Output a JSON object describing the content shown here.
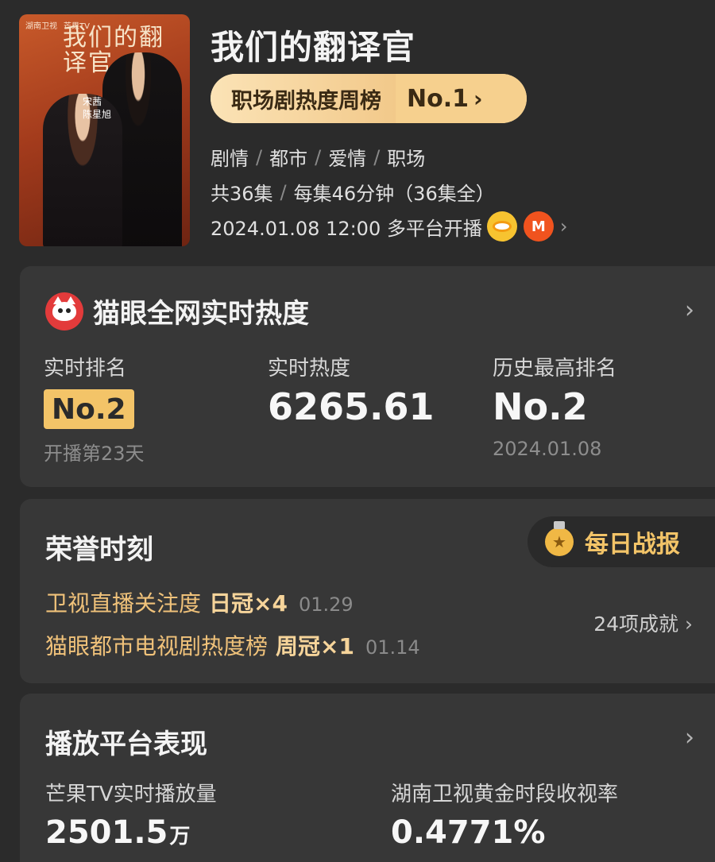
{
  "poster": {
    "logo_left": "湖南卫视",
    "logo_right": "芒果TV",
    "title_art": "我们的翻译官",
    "names": [
      "宋茜",
      "陈星旭"
    ]
  },
  "header": {
    "title": "我们的翻译官",
    "rank_label": "职场剧热度周榜",
    "rank_value": "No.1",
    "genres": [
      "剧情",
      "都市",
      "爱情",
      "职场"
    ],
    "episodes": "共36集",
    "duration": "每集46分钟（36集全）",
    "premiere": "2024.01.08 12:00 多平台开播",
    "platforms": [
      "hunan-tv-icon",
      "mango-tv-icon"
    ]
  },
  "heat_card": {
    "title": "猫眼全网实时热度",
    "stats": [
      {
        "label": "实时排名",
        "value": "No.2",
        "sub": "开播第23天"
      },
      {
        "label": "实时热度",
        "value": "6265.61",
        "sub": ""
      },
      {
        "label": "历史最高排名",
        "value": "No.2",
        "sub": "2024.01.08"
      }
    ]
  },
  "honor_card": {
    "title": "荣誉时刻",
    "daily_button": "每日战报",
    "items": [
      {
        "name": "卫视直播关注度",
        "crown": "日冠×4",
        "date": "01.29"
      },
      {
        "name": "猫眼都市电视剧热度榜",
        "crown": "周冠×1",
        "date": "01.14"
      }
    ],
    "achievements": "24项成就"
  },
  "platform_card": {
    "title": "播放平台表现",
    "metrics": [
      {
        "label": "芒果TV实时播放量",
        "value": "2501.5",
        "unit": "万"
      },
      {
        "label": "湖南卫视黄金时段收视率",
        "value": "0.4771%",
        "unit": ""
      }
    ]
  },
  "colors": {
    "background": "#2b2b2b",
    "card": "#373737",
    "accent_gold": "#f3c468",
    "honor_text": "#f0c27a"
  }
}
